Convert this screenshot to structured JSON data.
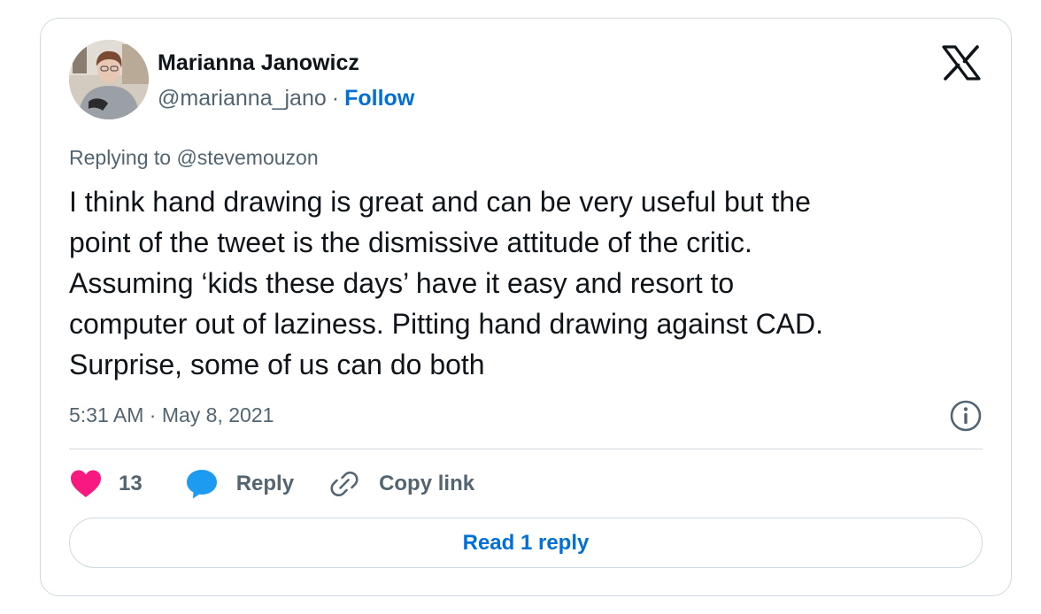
{
  "author": {
    "display_name": "Marianna Janowicz",
    "handle": "@marianna_jano",
    "separator": "·",
    "follow_label": "Follow"
  },
  "platform_icon": "x-logo-icon",
  "replying_to": "Replying to @stevemouzon",
  "tweet": {
    "text_lines": [
      "I think hand drawing is great and can be very useful but the",
      "point of the tweet is the dismissive attitude of the critic.",
      "Assuming ‘kids these days’ have it easy and resort to",
      "computer out of laziness. Pitting hand drawing against CAD.",
      "Surprise, some of us can do both"
    ],
    "timestamp": "5:31 AM · May 8, 2021"
  },
  "actions": {
    "like_count": "13",
    "reply_label": "Reply",
    "copy_link_label": "Copy link"
  },
  "read_replies_label": "Read 1 reply",
  "colors": {
    "text": "#0f1419",
    "muted": "#536471",
    "link": "#006fd6",
    "like": "#f91880",
    "reply_bubble": "#1d9bf0",
    "border": "#cfd9de"
  }
}
